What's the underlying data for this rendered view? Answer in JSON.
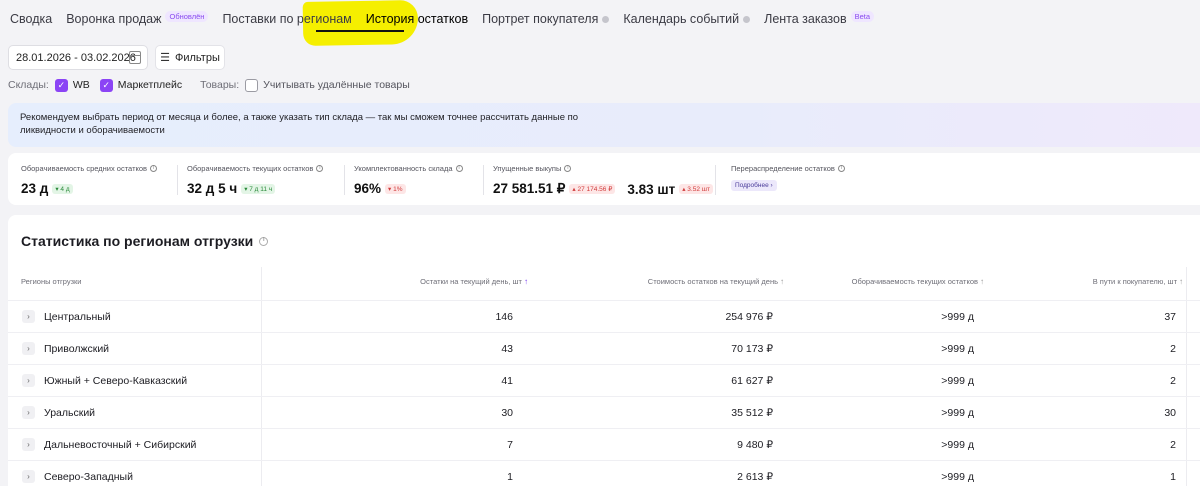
{
  "tabs": [
    {
      "label": "Сводка",
      "badge": "",
      "dot": false
    },
    {
      "label": "Воронка продаж",
      "badge": "Обновлён",
      "dot": false
    },
    {
      "label": "Поставки по регионам",
      "badge": "",
      "dot": false
    },
    {
      "label": "История остатков",
      "badge": "",
      "dot": false,
      "active": true
    },
    {
      "label": "Портрет покупателя",
      "badge": "",
      "dot": true
    },
    {
      "label": "Календарь событий",
      "badge": "",
      "dot": true
    },
    {
      "label": "Лента заказов",
      "badge": "Beta",
      "dot": false
    }
  ],
  "toolbar": {
    "date_range": "28.01.2026 - 03.02.2026",
    "filters_label": "Фильтры"
  },
  "filters": {
    "warehouses_label": "Склады:",
    "wb_label": "WB",
    "marketplace_label": "Маркетплейс",
    "goods_label": "Товары:",
    "deleted_label": "Учитывать удалённые товары"
  },
  "info": {
    "text": "Рекомендуем выбрать период от месяца и более, а также указать тип склада — так мы сможем точнее рассчитать данные по ликвидности и оборачиваемости"
  },
  "stats": {
    "avg_turnover": {
      "label": "Оборачиваемость средних остатков",
      "value": "23 д",
      "delta": "▾ 4 д"
    },
    "cur_turnover": {
      "label": "Оборачиваемость текущих остатков",
      "value": "32 д 5 ч",
      "delta": "▾ 7 д 11 ч"
    },
    "fill": {
      "label": "Укомплектованность склада",
      "value": "96%",
      "delta": "▾ 1%"
    },
    "lost": {
      "label": "Упущенные выкупы",
      "value": "27 581.51 ₽",
      "delta": "▴ 27 174.56 ₽",
      "value2": "3.83 шт",
      "delta2": "▴ 3.52 шт"
    },
    "redistribution": {
      "label": "Перераспределение остатков",
      "more": "Подробнее ›"
    }
  },
  "table": {
    "title": "Статистика по регионам отгрузки",
    "columns": {
      "region": "Регионы отгрузки",
      "stock": "Остатки на текущий день, шт",
      "cost": "Стоимость остатков на текущий день",
      "turnover": "Оборачиваемость текущих остатков",
      "transit": "В пути к покупателю, шт"
    },
    "rows": [
      {
        "region": "Центральный",
        "stock": "146",
        "cost": "254 976 ₽",
        "turnover": ">999 д",
        "transit": "37"
      },
      {
        "region": "Приволжский",
        "stock": "43",
        "cost": "70 173 ₽",
        "turnover": ">999 д",
        "transit": "2"
      },
      {
        "region": "Южный + Северо-Кавказский",
        "stock": "41",
        "cost": "61 627 ₽",
        "turnover": ">999 д",
        "transit": "2"
      },
      {
        "region": "Уральский",
        "stock": "30",
        "cost": "35 512 ₽",
        "turnover": ">999 д",
        "transit": "30"
      },
      {
        "region": "Дальневосточный + Сибирский",
        "stock": "7",
        "cost": "9 480 ₽",
        "turnover": ">999 д",
        "transit": "2"
      },
      {
        "region": "Северо-Западный",
        "stock": "1",
        "cost": "2 613 ₽",
        "turnover": ">999 д",
        "transit": "1"
      }
    ]
  }
}
